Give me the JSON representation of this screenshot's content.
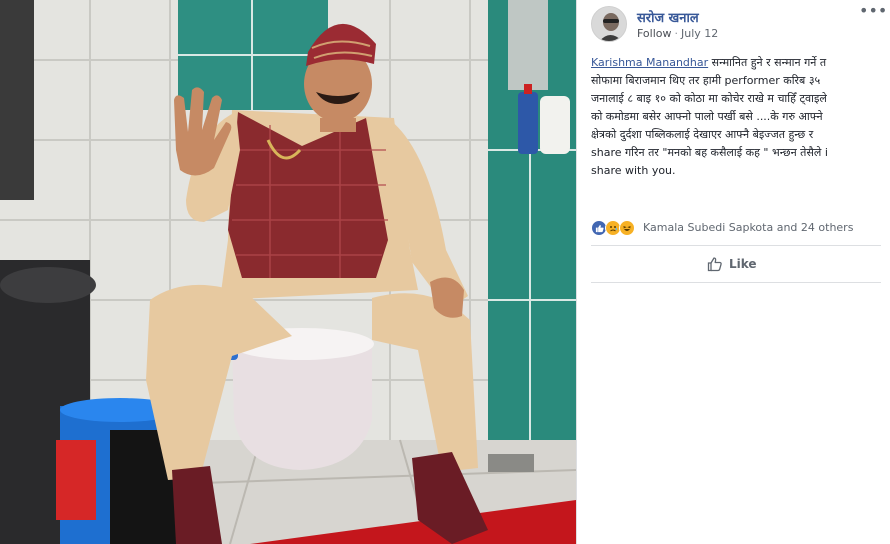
{
  "post": {
    "author": "सरोज खनाल",
    "follow_label": "Follow",
    "separator": "·",
    "date": "July 12",
    "more_label": "•••",
    "mention": "Karishma Manandhar",
    "body_lines": [
      " सन्मानित हुने र सन्मान गर्ने त",
      "सोफामा बिराजमान थिए तर हामी performer करिब ३५",
      "जनालाई ८ बाइ १० को कोठा मा कोचेर राखे म चाहिँ ट्वाइले",
      "को कमोडमा बसेर आफ्नो पालो पर्खी बसे ....के गरु आफ्ने",
      "क्षेत्रको दुर्दशा पब्लिकलाई देखाएर आफ्नै बेइज्जत हुन्छ र",
      "share गरिन तर \"मनको बह कसैलाई कह \" भन्छन तेसैले i",
      "share with you."
    ],
    "reactions": {
      "icons": [
        "like-icon",
        "sad-icon",
        "haha-icon"
      ],
      "names": "Kamala Subedi Sapkota and 24 others"
    },
    "like_label": "Like"
  },
  "colors": {
    "link": "#385898",
    "like_blue": "#4267b2",
    "reaction_yellow": "#f7b125",
    "tile_teal": "#2e8f82",
    "vest_red": "#8a2a2e",
    "outfit_beige": "#e7c9a0",
    "mat_red": "#c4161c"
  }
}
